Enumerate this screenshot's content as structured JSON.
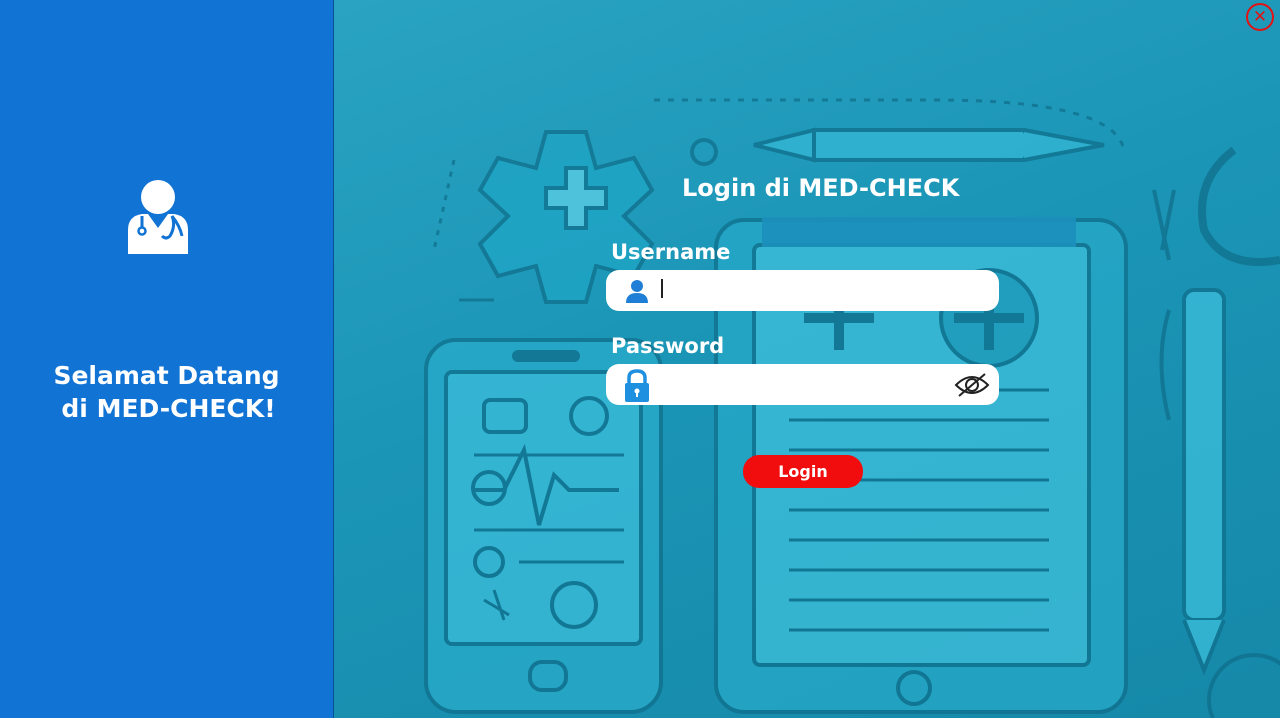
{
  "sidebar": {
    "welcome_line1": "Selamat Datang",
    "welcome_line2": "di MED-CHECK!",
    "icon": "doctor-icon"
  },
  "login": {
    "title": "Login di MED-CHECK",
    "username_label": "Username",
    "username_value": "",
    "password_label": "Password",
    "password_value": "",
    "button_label": "Login"
  },
  "icons": {
    "close": "close-icon",
    "user": "user-icon",
    "lock": "lock-icon",
    "eye": "eye-slash-icon"
  },
  "colors": {
    "sidebar": "#1173d3",
    "background": "#1a8aab",
    "login_button": "#f10d0d",
    "close_button": "#e01414",
    "icon_blue": "#1f7fd6"
  }
}
